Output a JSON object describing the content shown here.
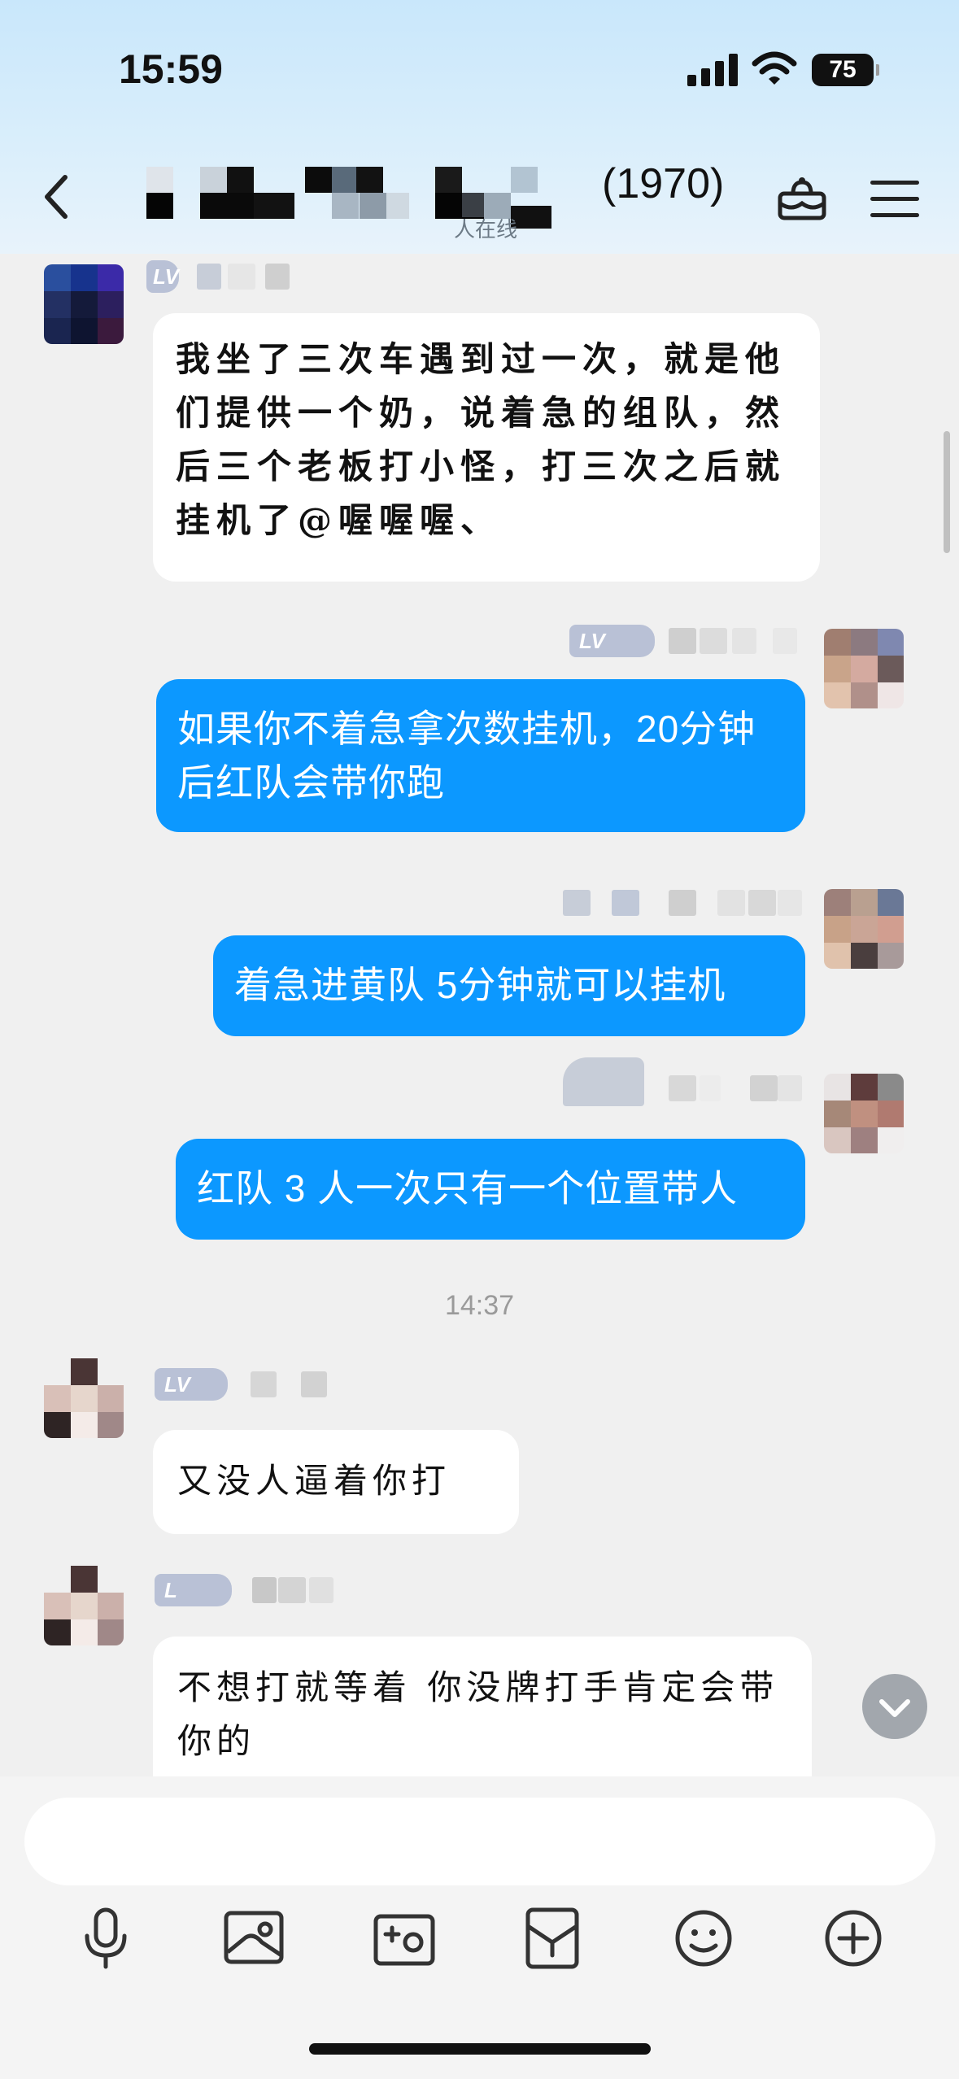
{
  "status": {
    "time": "15:59",
    "battery": "75"
  },
  "header": {
    "title_count": "(1970)",
    "subtitle": "人在线"
  },
  "messages": [
    {
      "direction": "incoming",
      "level_badge": "LV",
      "text": "我坐了三次车遇到过一次，就是他们提供一个奶，说着急的组队，然后三个老板打小怪，打三次之后就挂机了@喔喔喔、"
    },
    {
      "direction": "outgoing",
      "level_badge": "LV",
      "text": "如果你不着急拿次数挂机，20分钟后红队会带你跑"
    },
    {
      "direction": "outgoing",
      "text": "着急进黄队 5分钟就可以挂机"
    },
    {
      "direction": "outgoing",
      "text": "红队 3 人一次只有一个位置带人"
    },
    {
      "direction": "incoming",
      "level_badge": "LV",
      "text": "又没人逼着你打"
    },
    {
      "direction": "incoming",
      "level_badge": "L",
      "text": "不想打就等着  你没牌打手肯定会带你的"
    }
  ],
  "timestamp": "14:37",
  "icons": {
    "back": "chevron-left-icon",
    "gift": "gift-icon",
    "menu": "menu-icon",
    "jump_down": "chevron-down-icon",
    "toolbar": [
      "microphone-icon",
      "image-icon",
      "camera-icon",
      "red-packet-icon",
      "emoji-icon",
      "plus-icon"
    ]
  },
  "colors": {
    "outgoing_bubble": "#0c98ff",
    "incoming_bubble": "#ffffff",
    "header_gradient": "#c9e7fb"
  }
}
